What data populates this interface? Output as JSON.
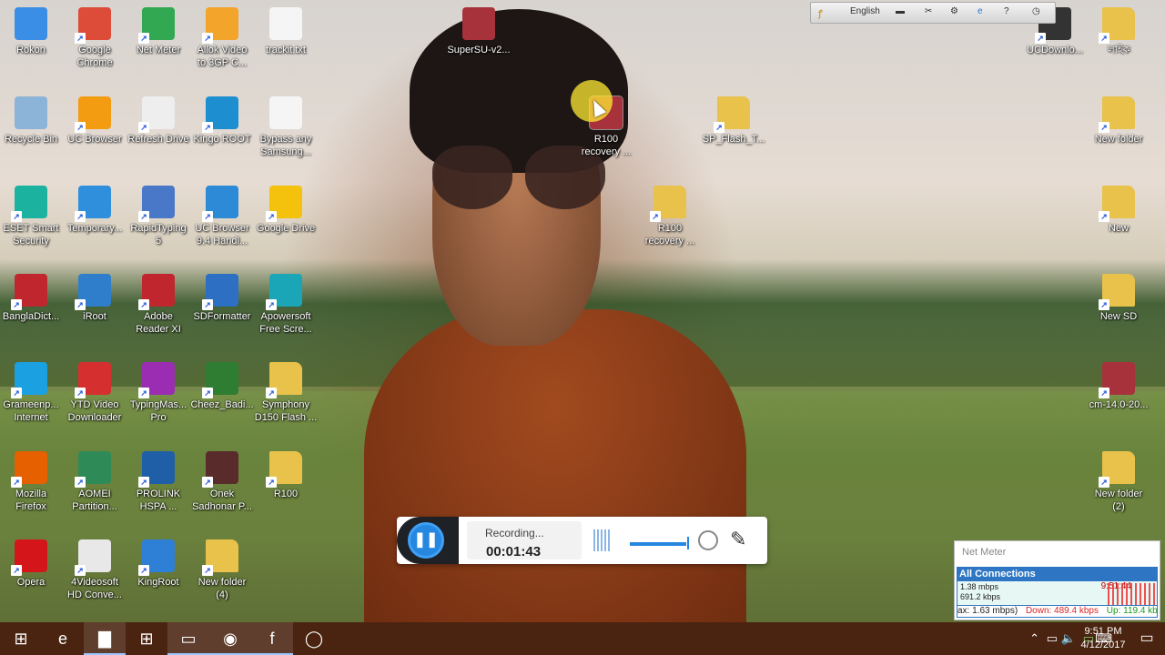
{
  "desktop": {
    "icons": [
      {
        "label": "Rokon",
        "icon": "computer-icon",
        "color": "#3a8ee6"
      },
      {
        "label": "Google\nChrome",
        "icon": "chrome-icon",
        "color": "#dd4b39"
      },
      {
        "label": "Net Meter",
        "icon": "net-meter-icon",
        "color": "#32a852"
      },
      {
        "label": "Allok Video\nto 3GP C...",
        "icon": "allok-video-icon",
        "color": "#f2a52a"
      },
      {
        "label": "trackit.txt",
        "icon": "text-file-icon",
        "color": "#f5f5f5"
      },
      {
        "label": "Recycle Bin",
        "icon": "recycle-bin-icon",
        "color": "#8bb4d8"
      },
      {
        "label": "UC Browser",
        "icon": "uc-browser-icon",
        "color": "#f39c12"
      },
      {
        "label": "Refresh Drive",
        "icon": "refresh-drive-icon",
        "color": "#eeeeee"
      },
      {
        "label": "Kingo ROOT",
        "icon": "kingo-root-icon",
        "color": "#1d8fd1"
      },
      {
        "label": "Bypass any\nSamsung...",
        "icon": "blank-file-icon",
        "color": "#f5f5f5"
      },
      {
        "label": "ESET Smart\nSecurity",
        "icon": "eset-icon",
        "color": "#1bb3a0"
      },
      {
        "label": "Temporary...",
        "icon": "windows-flag-icon",
        "color": "#2f8fdd"
      },
      {
        "label": "RapidTyping\n5",
        "icon": "rapidtyping-icon",
        "color": "#4a78c8"
      },
      {
        "label": "UC Browser\n9.4 Handl...",
        "icon": "uc-browser-blue-icon",
        "color": "#2c8ad6"
      },
      {
        "label": "Google Drive",
        "icon": "google-drive-icon",
        "color": "#f4c20d"
      },
      {
        "label": "BanglaDict...",
        "icon": "bangla-dict-icon",
        "color": "#c0262d"
      },
      {
        "label": "iRoot",
        "icon": "iroot-anchor-icon",
        "color": "#2f7ecb"
      },
      {
        "label": "Adobe\nReader XI",
        "icon": "adobe-reader-icon",
        "color": "#c0262d"
      },
      {
        "label": "SDFormatter",
        "icon": "sd-formatter-icon",
        "color": "#2d6fc2"
      },
      {
        "label": "Apowersoft\nFree Scre...",
        "icon": "apowersoft-icon",
        "color": "#1aa6b7"
      },
      {
        "label": "Grameenp...\nInternet",
        "icon": "grameenphone-icon",
        "color": "#1ba1e2"
      },
      {
        "label": "YTD Video\nDownloader",
        "icon": "ytd-downloader-icon",
        "color": "#d62f2f"
      },
      {
        "label": "TypingMas...\nPro",
        "icon": "typingmaster-icon",
        "color": "#9b2db3"
      },
      {
        "label": "Cheez_Badi...",
        "icon": "mp3-file-icon",
        "color": "#2e7d32"
      },
      {
        "label": "Symphony\nD150 Flash ...",
        "icon": "folder-icon",
        "color": "#e8c24a"
      },
      {
        "label": "Mozilla\nFirefox",
        "icon": "firefox-icon",
        "color": "#e66000"
      },
      {
        "label": "AOMEI\nPartition...",
        "icon": "aomei-icon",
        "color": "#2e8b57"
      },
      {
        "label": "PROLINK\nHSPA ...",
        "icon": "prolink-3g-icon",
        "color": "#1f5fa8"
      },
      {
        "label": "Onek\nSadhonar P...",
        "icon": "video-file-icon",
        "color": "#5a2b2b"
      },
      {
        "label": "R100",
        "icon": "folder-icon",
        "color": "#e8c24a"
      },
      {
        "label": "Opera",
        "icon": "opera-icon",
        "color": "#d4161b"
      },
      {
        "label": "4Videosoft\nHD Conve...",
        "icon": "4videosoft-icon",
        "color": "#e8e8e8"
      },
      {
        "label": "KingRoot",
        "icon": "kingroot-icon",
        "color": "#2e7fd6"
      },
      {
        "label": "New folder\n(4)",
        "icon": "folder-icon",
        "color": "#e8c24a"
      },
      {
        "label": "SuperSU-v2...",
        "icon": "winrar-icon",
        "color": "#a8323c"
      },
      {
        "label": "R100\nrecovery ...",
        "icon": "winrar-icon",
        "color": "#a8323c"
      },
      {
        "label": "SP_Flash_T...",
        "icon": "folder-icon",
        "color": "#e8c24a"
      },
      {
        "label": "R100\nrecovery ...",
        "icon": "folder-icon",
        "color": "#e8c24a"
      },
      {
        "label": "UCDownlo...",
        "icon": "uc-downloads-icon",
        "color": "#333333"
      },
      {
        "label": "লাইক",
        "icon": "folder-icon",
        "color": "#e8c24a"
      },
      {
        "label": "New folder",
        "icon": "folder-icon",
        "color": "#e8c24a"
      },
      {
        "label": "New",
        "icon": "folder-icon",
        "color": "#e8c24a"
      },
      {
        "label": "New SD",
        "icon": "folder-icon",
        "color": "#e8c24a"
      },
      {
        "label": "cm-14.0-20...",
        "icon": "winrar-icon",
        "color": "#a8323c"
      },
      {
        "label": "New folder\n(2)",
        "icon": "folder-icon",
        "color": "#e8c24a"
      }
    ]
  },
  "language_bar": {
    "language": "English"
  },
  "recorder": {
    "status": "Recording...",
    "elapsed": "00:01:43",
    "pause_icon": "pause-icon",
    "volume_level": 1.0
  },
  "net_meter": {
    "title": "Net Meter",
    "section": "All Connections",
    "rate1": "1.38 mbps",
    "rate2": "691.2 kbps",
    "time": "9:51:44",
    "max": "ax: 1.63 mbps)",
    "down": "Down: 489.4 kbps",
    "up": "Up: 119.4 kb"
  },
  "taskbar": {
    "apps": [
      {
        "icon": "windows-start-icon",
        "glyph": "⊞"
      },
      {
        "icon": "edge-icon",
        "glyph": "e"
      },
      {
        "icon": "file-explorer-icon",
        "glyph": "▇"
      },
      {
        "icon": "store-icon",
        "glyph": "⊞"
      },
      {
        "icon": "screen-recorder-icon",
        "glyph": "▭"
      },
      {
        "icon": "firefox-icon",
        "glyph": "◉"
      },
      {
        "icon": "facebook-icon",
        "glyph": "f"
      },
      {
        "icon": "messenger-icon",
        "glyph": "◯"
      }
    ],
    "clock_time": "9:51 PM",
    "clock_date": "4/12/2017"
  }
}
